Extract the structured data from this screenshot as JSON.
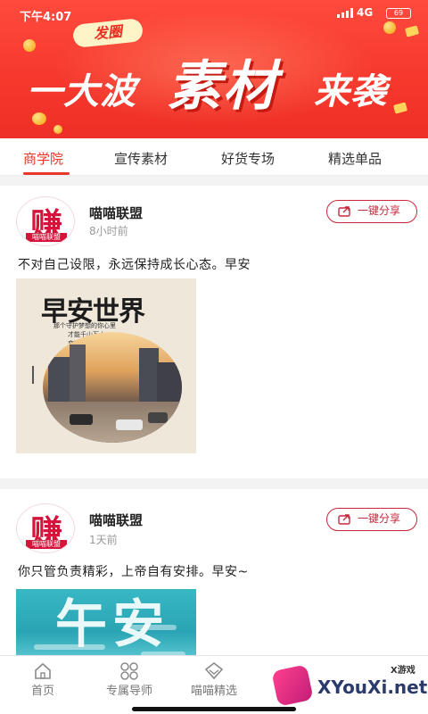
{
  "status_bar": {
    "time": "下午4:07",
    "network": "4G",
    "battery": "69"
  },
  "banner": {
    "tag": "发圈",
    "headline_left": "一大波",
    "headline_mid": "素材",
    "headline_right": "来袭"
  },
  "tabs": [
    {
      "label": "商学院",
      "active": true
    },
    {
      "label": "宣传素材",
      "active": false
    },
    {
      "label": "好货专场",
      "active": false
    },
    {
      "label": "精选单品",
      "active": false
    }
  ],
  "posts": [
    {
      "avatar_char": "赚",
      "avatar_band": "喵喵联盟",
      "user": "喵喵联盟",
      "time": "8小时前",
      "share_label": "一键分享",
      "text": "不对自己设限，永远保持成长心态。早安",
      "image_title": "早安世界",
      "image_lines": [
        "那个守护梦想的你心里",
        "才能千山万水",
        "恋不畏惧"
      ]
    },
    {
      "avatar_char": "赚",
      "avatar_band": "喵喵联盟",
      "user": "喵喵联盟",
      "time": "1天前",
      "share_label": "一键分享",
      "text": "你只管负责精彩，上帝自有安排。早安~",
      "image_title": "午安"
    }
  ],
  "bottom_nav": [
    {
      "label": "首页",
      "icon": "home-icon"
    },
    {
      "label": "专属导师",
      "icon": "grid-icon"
    },
    {
      "label": "喵喵精选",
      "icon": "diamond-icon"
    }
  ],
  "watermark": {
    "brand": "XYouXi.net",
    "small": "X游戏"
  },
  "colors": {
    "banner_red": "#f5372c",
    "accent_red": "#e8362b",
    "share_red": "#c8283a"
  }
}
